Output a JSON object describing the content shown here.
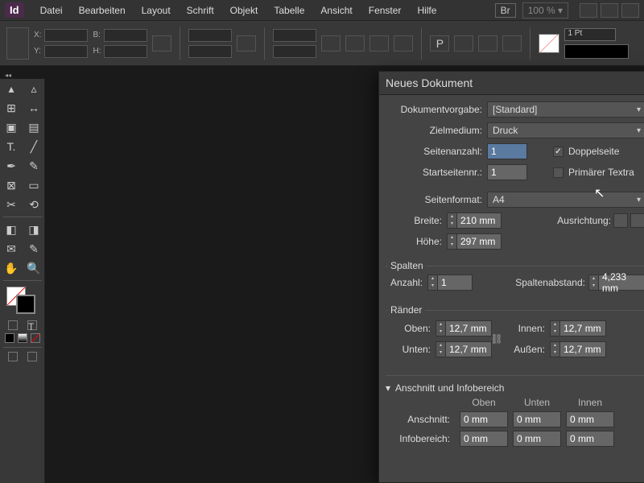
{
  "app": {
    "badge": "Id"
  },
  "menu": {
    "items": [
      "Datei",
      "Bearbeiten",
      "Layout",
      "Schrift",
      "Objekt",
      "Tabelle",
      "Ansicht",
      "Fenster",
      "Hilfe"
    ],
    "bridge": "Br",
    "zoom": "100 %"
  },
  "control": {
    "x": "X:",
    "y": "Y:",
    "b": "B:",
    "h": "H:",
    "stroke_weight": "1 Pt"
  },
  "dialog": {
    "title": "Neues Dokument",
    "labels": {
      "preset": "Dokumentvorgabe:",
      "intent": "Zielmedium:",
      "pages": "Seitenanzahl:",
      "start": "Startseitennr.:",
      "facing": "Doppelseite",
      "textframe": "Primärer Textra",
      "pagesize": "Seitenformat:",
      "width": "Breite:",
      "height": "Höhe:",
      "orientation": "Ausrichtung:",
      "columns_title": "Spalten",
      "col_count": "Anzahl:",
      "gutter": "Spaltenabstand:",
      "margins_title": "Ränder",
      "top": "Oben:",
      "bottom": "Unten:",
      "inside": "Innen:",
      "outside": "Außen:",
      "bleed_section": "Anschnitt und Infobereich",
      "bleed": "Anschnitt:",
      "slug": "Infobereich:",
      "col_top": "Oben",
      "col_bottom": "Unten",
      "col_inside": "Innen"
    },
    "values": {
      "preset": "[Standard]",
      "intent": "Druck",
      "pages": "1",
      "start": "1",
      "facing": true,
      "textframe": false,
      "pagesize": "A4",
      "width": "210 mm",
      "height": "297 mm",
      "col_count": "1",
      "gutter": "4,233 mm",
      "m_top": "12,7 mm",
      "m_bottom": "12,7 mm",
      "m_inside": "12,7 mm",
      "m_outside": "12,7 mm",
      "b_top": "0 mm",
      "b_bottom": "0 mm",
      "b_inside": "0 mm",
      "s_top": "0 mm",
      "s_bottom": "0 mm",
      "s_inside": "0 mm"
    }
  }
}
